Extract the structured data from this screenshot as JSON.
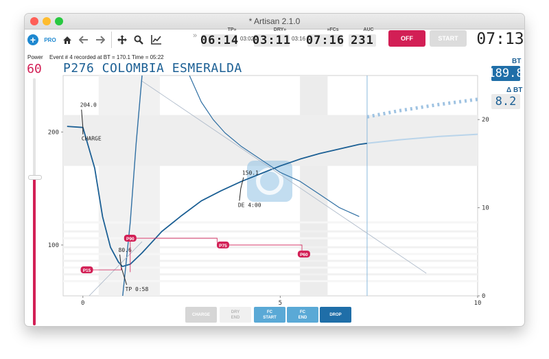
{
  "window": {
    "title": "* Artisan 2.1.0"
  },
  "toolbar": {
    "pro_label": "PRO",
    "icons": [
      "plus-icon",
      "home-icon",
      "back-arrow-icon",
      "forward-arrow-icon",
      "move-icon",
      "zoom-icon",
      "chart-icon",
      "double-chevron-icon"
    ]
  },
  "phases": {
    "tp": {
      "label": "TP»",
      "value": "06:14",
      "elapsed": "03:02"
    },
    "dry": {
      "label": "DRY»",
      "value": "03:11",
      "elapsed": "03:16"
    },
    "fcs": {
      "label": "»FCs",
      "value": "07:16"
    },
    "auc": {
      "label": "AUC",
      "value": "231"
    }
  },
  "buttons": {
    "off": "OFF",
    "start": "START"
  },
  "timer": "07:13",
  "power": {
    "label": "Power",
    "value": "60",
    "level": 0.6
  },
  "message": "Event # 4 recorded at BT = 170.1  Time = 05:22",
  "profile_title": "P276 COLOMBIA ESMERALDA",
  "readouts": {
    "bt_label": "BT",
    "bt_value": "189.8",
    "delta_label": "Δ BT",
    "delta_value": "8.2"
  },
  "annotations": {
    "charge_temp": "204.0",
    "charge": "CHARGE",
    "tp_temp": "80.6",
    "tp": "TP 0:58",
    "de_temp": "150.1",
    "de": "DE 4:00"
  },
  "markers": [
    "P15",
    "P90",
    "P75",
    "P60"
  ],
  "event_buttons": {
    "charge": "CHARGE",
    "dry_end": [
      "DRY",
      "END"
    ],
    "fc_start": [
      "FC",
      "START"
    ],
    "fc_end": [
      "FC",
      "END"
    ],
    "drop": "DROP"
  },
  "colors": {
    "accent_red": "#d21f55",
    "bt_blue": "#1b5f94",
    "et_blue": "#2f6fa3",
    "button_blue": "#5aa9d6",
    "drop_blue": "#1f6ea8"
  },
  "chart_data": {
    "type": "line",
    "x_unit": "minutes",
    "xlim": [
      -0.5,
      10
    ],
    "ylim_left": [
      55,
      250
    ],
    "ylim_right": [
      0,
      25
    ],
    "x_ticks": [
      "0",
      "5",
      "10"
    ],
    "y_ticks_left": [
      "100",
      "200"
    ],
    "y_ticks_right": [
      "0",
      "10",
      "20"
    ],
    "series": [
      {
        "role": "BT",
        "axis": "left",
        "x": [
          -0.4,
          0,
          0.3,
          0.5,
          0.7,
          0.9,
          1.0,
          1.2,
          1.5,
          2.0,
          2.5,
          3.0,
          3.5,
          4.0,
          4.5,
          5.0,
          5.5,
          6.0,
          6.5,
          7.0,
          7.2
        ],
        "y": [
          205,
          204,
          168,
          125,
          98,
          85,
          81,
          83,
          93,
          112,
          126,
          139,
          148,
          156,
          163,
          170,
          176,
          181,
          185,
          189,
          190
        ]
      },
      {
        "role": "BT projection",
        "axis": "left",
        "x": [
          7.2,
          8,
          9,
          10
        ],
        "y": [
          190,
          193,
          196,
          198
        ]
      },
      {
        "role": "ET",
        "axis": "left",
        "x": [
          1.0,
          1.2,
          1.35,
          1.5
        ],
        "y": [
          52,
          120,
          190,
          250
        ]
      },
      {
        "role": "ΔBT",
        "axis": "right",
        "x": [
          2.7,
          3.0,
          3.3,
          3.6,
          4.0,
          4.5,
          5.0,
          5.5,
          6.0,
          6.5,
          7.0
        ],
        "y": [
          25,
          22,
          20,
          18.5,
          17,
          15.5,
          14,
          13,
          11.5,
          10,
          9
        ]
      },
      {
        "role": "ΔBT projection",
        "axis": "right",
        "x": [
          7.2,
          8,
          9,
          10
        ],
        "y": [
          20.3,
          21,
          21.7,
          22.3
        ]
      },
      {
        "role": "reference",
        "axis": "left",
        "x": [
          -0.4,
          1.5
        ],
        "y": [
          35,
          103
        ]
      },
      {
        "role": "reference",
        "axis": "left",
        "x": [
          1.5,
          8.7
        ],
        "y": [
          245,
          75
        ]
      }
    ],
    "events": [
      {
        "name": "CHARGE",
        "x": 0,
        "y": 204.0
      },
      {
        "name": "TP",
        "x": 0.97,
        "y": 80.6
      },
      {
        "name": "DE",
        "x": 4.0,
        "y": 150.1
      }
    ],
    "drop_marker_x": 7.2
  }
}
